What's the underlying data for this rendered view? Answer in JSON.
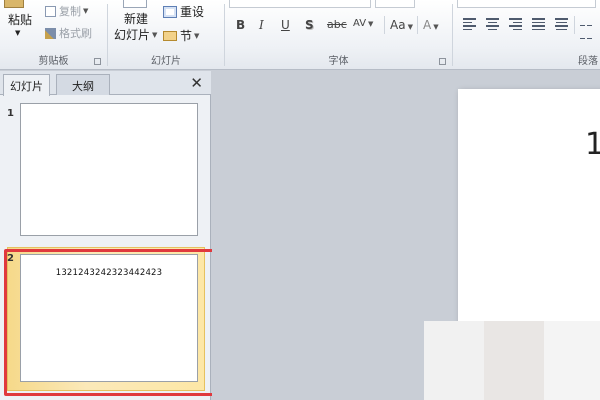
{
  "clipboard": {
    "paste": "粘贴",
    "copy": "复制",
    "format_painter": "格式刷",
    "group_label": "剪贴板"
  },
  "slides": {
    "new_line1": "新建",
    "new_line2": "幻灯片",
    "reset": "重设",
    "section": "节",
    "group_label": "幻灯片"
  },
  "font": {
    "bold": "B",
    "italic": "I",
    "underline": "U",
    "shadow": "S",
    "strike": "abc",
    "spacing": "AV",
    "case": "Aa",
    "color": "A",
    "group_label": "字体"
  },
  "paragraph": {
    "group_label": "段落"
  },
  "pane": {
    "tabs": [
      {
        "label": "幻灯片"
      },
      {
        "label": "大纲"
      }
    ],
    "close": "✕",
    "thumbnails": [
      {
        "number": "1",
        "text": ""
      },
      {
        "number": "2",
        "text": "1321243242323442423"
      }
    ]
  },
  "editor": {
    "slide_text": "1"
  },
  "colors": {
    "selection_outline": "#e0393d",
    "thumbnail_selected": "#fbe9b9"
  }
}
